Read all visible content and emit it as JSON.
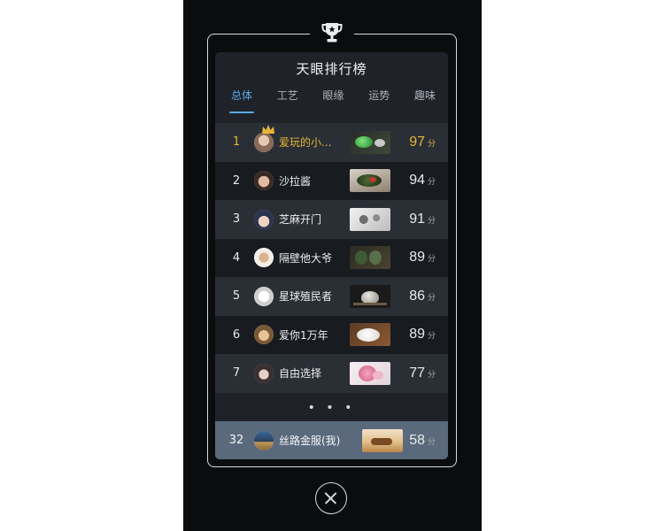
{
  "panel": {
    "title": "天眼排行榜",
    "tabs": [
      {
        "label": "总体",
        "active": true
      },
      {
        "label": "工艺",
        "active": false
      },
      {
        "label": "眼缘",
        "active": false
      },
      {
        "label": "运势",
        "active": false
      },
      {
        "label": "趣味",
        "active": false
      }
    ],
    "score_unit": "分",
    "rows": [
      {
        "rank": "1",
        "name": "爱玩的小...",
        "score": "97",
        "highlight": true,
        "avatar_color": "#b99c8a",
        "thumb": "jade-green"
      },
      {
        "rank": "2",
        "name": "沙拉酱",
        "score": "94",
        "highlight": false,
        "avatar_color": "#6b4a3e",
        "thumb": "jade-dark"
      },
      {
        "rank": "3",
        "name": "芝麻开门",
        "score": "91",
        "highlight": false,
        "avatar_color": "#3a3f55",
        "thumb": "stone-white"
      },
      {
        "rank": "4",
        "name": "隔壁他大爷",
        "score": "89",
        "highlight": false,
        "avatar_color": "#6a5a45",
        "thumb": "jade-olive"
      },
      {
        "rank": "5",
        "name": "星球殖民者",
        "score": "86",
        "highlight": false,
        "avatar_color": "#e8e8e8",
        "thumb": "teapot"
      },
      {
        "rank": "6",
        "name": "爱你1万年",
        "score": "89",
        "highlight": false,
        "avatar_color": "#9a7a55",
        "thumb": "white-jade"
      },
      {
        "rank": "7",
        "name": "自由选择",
        "score": "77",
        "highlight": false,
        "avatar_color": "#4a4040",
        "thumb": "flower-pink"
      }
    ],
    "more": "• • •",
    "mine": {
      "rank": "32",
      "name": "丝路金服(我)",
      "score": "58",
      "avatar_color": "#2d3e5a",
      "thumb": "camel-desert"
    }
  },
  "colors": {
    "accent_tab": "#5aa8e6",
    "gold": "#e7b637",
    "mine_row": "#5a6a7c"
  },
  "icons": {
    "top": "trophy-icon",
    "crown": "crown-icon",
    "close": "close-icon"
  }
}
